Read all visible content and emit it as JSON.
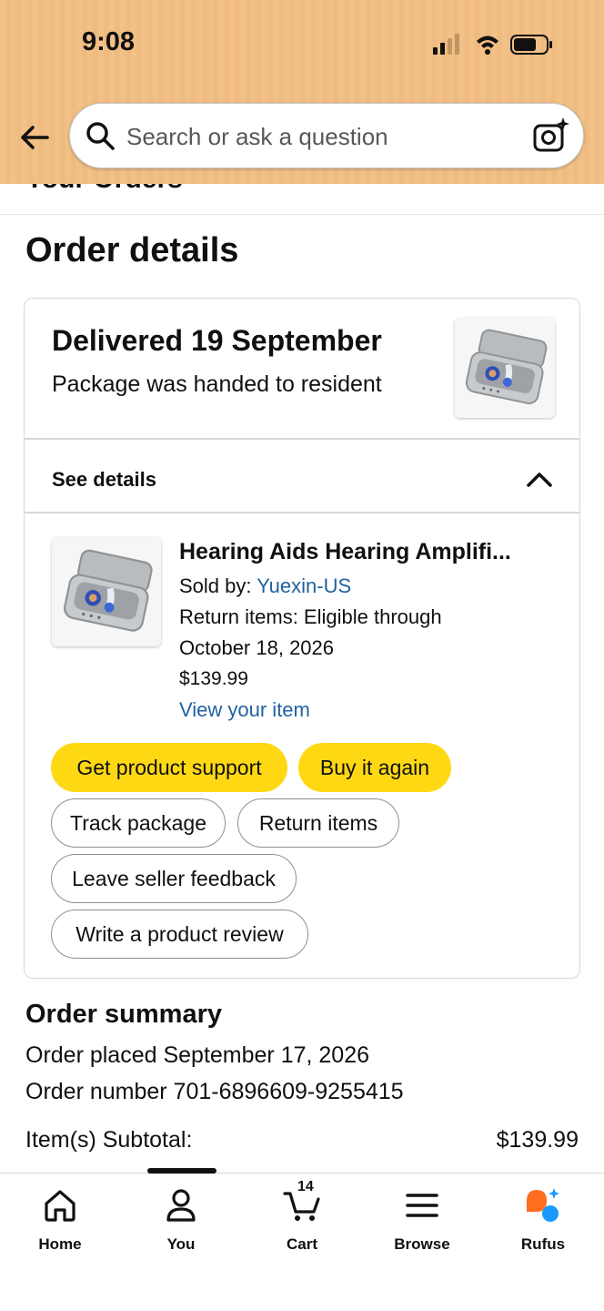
{
  "status_bar": {
    "time": "9:08"
  },
  "header": {
    "back_icon": "arrow-left-icon",
    "search": {
      "placeholder": "Search or ask a question",
      "value": ""
    },
    "camera_icon": "camera-sparkle-icon",
    "breadcrumb": "Your Orders"
  },
  "page": {
    "title": "Order details"
  },
  "delivery": {
    "title": "Delivered 19 September",
    "subtitle": "Package was handed to resident",
    "see_details": "See details"
  },
  "item": {
    "title": "Hearing Aids Hearing Amplifi...",
    "sold_by_label": "Sold by:",
    "seller": "Yuexin-US",
    "return_line1": "Return items: Eligible through",
    "return_line2": "October 18, 2026",
    "price": "$139.99",
    "view_item": "View your item"
  },
  "actions": {
    "get_support": "Get product support",
    "buy_again": "Buy it again",
    "track": "Track package",
    "return": "Return items",
    "seller_feedback": "Leave seller feedback",
    "review": "Write a product review"
  },
  "summary": {
    "title": "Order summary",
    "placed": "Order placed September 17, 2026",
    "number": "Order number 701-6896609-9255415",
    "subtotal_label": "Item(s) Subtotal:",
    "subtotal_value": "$139.99"
  },
  "bottom_nav": {
    "items": [
      {
        "label": "Home",
        "icon": "home-icon"
      },
      {
        "label": "You",
        "icon": "person-icon"
      },
      {
        "label": "Cart",
        "icon": "cart-icon",
        "badge": "14"
      },
      {
        "label": "Browse",
        "icon": "menu-icon"
      },
      {
        "label": "Rufus",
        "icon": "rufus-icon"
      }
    ]
  },
  "colors": {
    "header_bg": "#f2c187",
    "button_yellow": "#ffd814",
    "link": "#2162a1",
    "rufus_orange": "#ff6d1f",
    "rufus_blue": "#1a98ff"
  }
}
